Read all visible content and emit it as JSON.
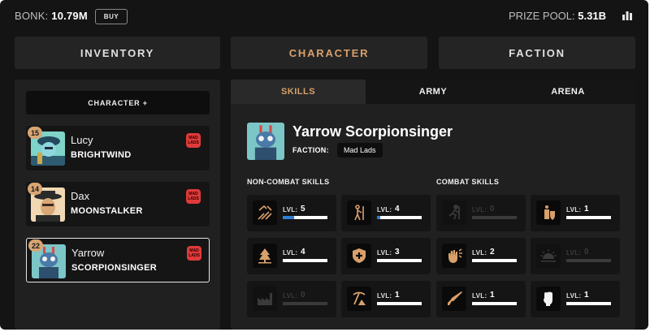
{
  "topbar": {
    "bonk_label": "BONK:",
    "bonk_value": "10.79M",
    "buy_label": "BUY",
    "prize_label": "PRIZE POOL:",
    "prize_value": "5.31B",
    "stats_icon": "bar-chart-icon"
  },
  "main_tabs": [
    {
      "label": "INVENTORY",
      "active": false
    },
    {
      "label": "CHARACTER",
      "active": true
    },
    {
      "label": "FACTION",
      "active": false
    }
  ],
  "sidebar": {
    "add_character_label": "CHARACTER +",
    "characters": [
      {
        "level": "15",
        "first_name": "Lucy",
        "last_name": "BRIGHTWIND",
        "faction_badge": "MAD LADS",
        "selected": false
      },
      {
        "level": "14",
        "first_name": "Dax",
        "last_name": "MOONSTALKER",
        "faction_badge": "MAD LADS",
        "selected": false
      },
      {
        "level": "22",
        "first_name": "Yarrow",
        "last_name": "SCORPIONSINGER",
        "faction_badge": "MAD LADS",
        "selected": true
      }
    ]
  },
  "detail": {
    "sub_tabs": [
      {
        "label": "SKILLS",
        "active": true
      },
      {
        "label": "ARMY",
        "active": false
      },
      {
        "label": "ARENA",
        "active": false
      }
    ],
    "hero_name": "Yarrow Scorpionsinger",
    "faction_label": "FACTION:",
    "faction_value": "Mad Lads",
    "non_combat_title": "NON-COMBAT SKILLS",
    "combat_title": "COMBAT SKILLS",
    "lvl_label": "LVL:",
    "non_combat_skills": [
      {
        "icon": "woodcutting-icon",
        "level": "5",
        "progress": 0.25,
        "locked": false
      },
      {
        "icon": "fishing-icon",
        "level": "4",
        "progress": 0.08,
        "locked": false
      },
      {
        "icon": "forestry-icon",
        "level": "4",
        "progress": 0.0,
        "locked": false
      },
      {
        "icon": "healing-icon",
        "level": "3",
        "progress": 0.0,
        "locked": false
      },
      {
        "icon": "factory-icon",
        "level": "0",
        "progress": 0.0,
        "locked": true
      },
      {
        "icon": "mining-icon",
        "level": "1",
        "progress": 0.0,
        "locked": false
      }
    ],
    "combat_skills": [
      {
        "icon": "running-icon",
        "level": "0",
        "progress": 0.0,
        "locked": true
      },
      {
        "icon": "defense-icon",
        "level": "1",
        "progress": 0.0,
        "locked": false
      },
      {
        "icon": "magic-hand-icon",
        "level": "2",
        "progress": 0.0,
        "locked": false
      },
      {
        "icon": "sunrise-icon",
        "level": "0",
        "progress": 0.0,
        "locked": true
      },
      {
        "icon": "rifle-icon",
        "level": "1",
        "progress": 0.0,
        "locked": false
      },
      {
        "icon": "fist-icon",
        "level": "1",
        "progress": 0.0,
        "locked": false
      }
    ]
  },
  "colors": {
    "accent": "#d9a06b",
    "progress": "#2f7fd6",
    "badge": "#e03a3a"
  }
}
